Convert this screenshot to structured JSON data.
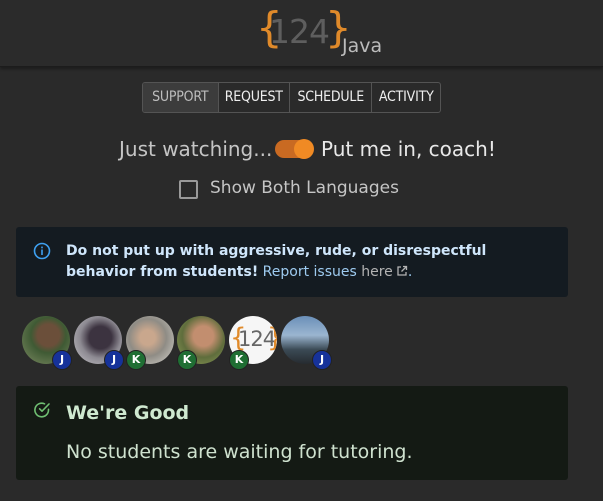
{
  "header": {
    "logo_left_brace": "{",
    "logo_number": "124",
    "logo_right_brace": "}",
    "logo_language": "Java",
    "accent_color": "#e08a2a"
  },
  "tabs": [
    {
      "label": "SUPPORT",
      "active": true
    },
    {
      "label": "REQUEST",
      "active": false
    },
    {
      "label": "SCHEDULE",
      "active": false
    },
    {
      "label": "ACTIVITY",
      "active": false
    }
  ],
  "mode_toggle": {
    "left_label": "Just watching...",
    "right_label": "Put me in, coach!",
    "on": true,
    "color": "#f08a24"
  },
  "languages_option": {
    "label": "Show Both Languages",
    "checked": false
  },
  "notice": {
    "icon": "info-icon",
    "bold_text": "Do not put up with aggressive, rude, or disrespectful behavior from students!",
    "text": " Report issues ",
    "link_label": "here",
    "end": "."
  },
  "staff": [
    {
      "avatar": "photo",
      "badge": "J"
    },
    {
      "avatar": "photo",
      "badge": "J"
    },
    {
      "avatar": "photo",
      "badge": "K"
    },
    {
      "avatar": "photo",
      "badge": "K"
    },
    {
      "avatar": "logo",
      "logo_text": "124",
      "badge": "K"
    },
    {
      "avatar": "photo",
      "badge": "J"
    }
  ],
  "status": {
    "icon": "check-circle-icon",
    "title": "We're Good",
    "message": "No students are waiting for tutoring."
  }
}
